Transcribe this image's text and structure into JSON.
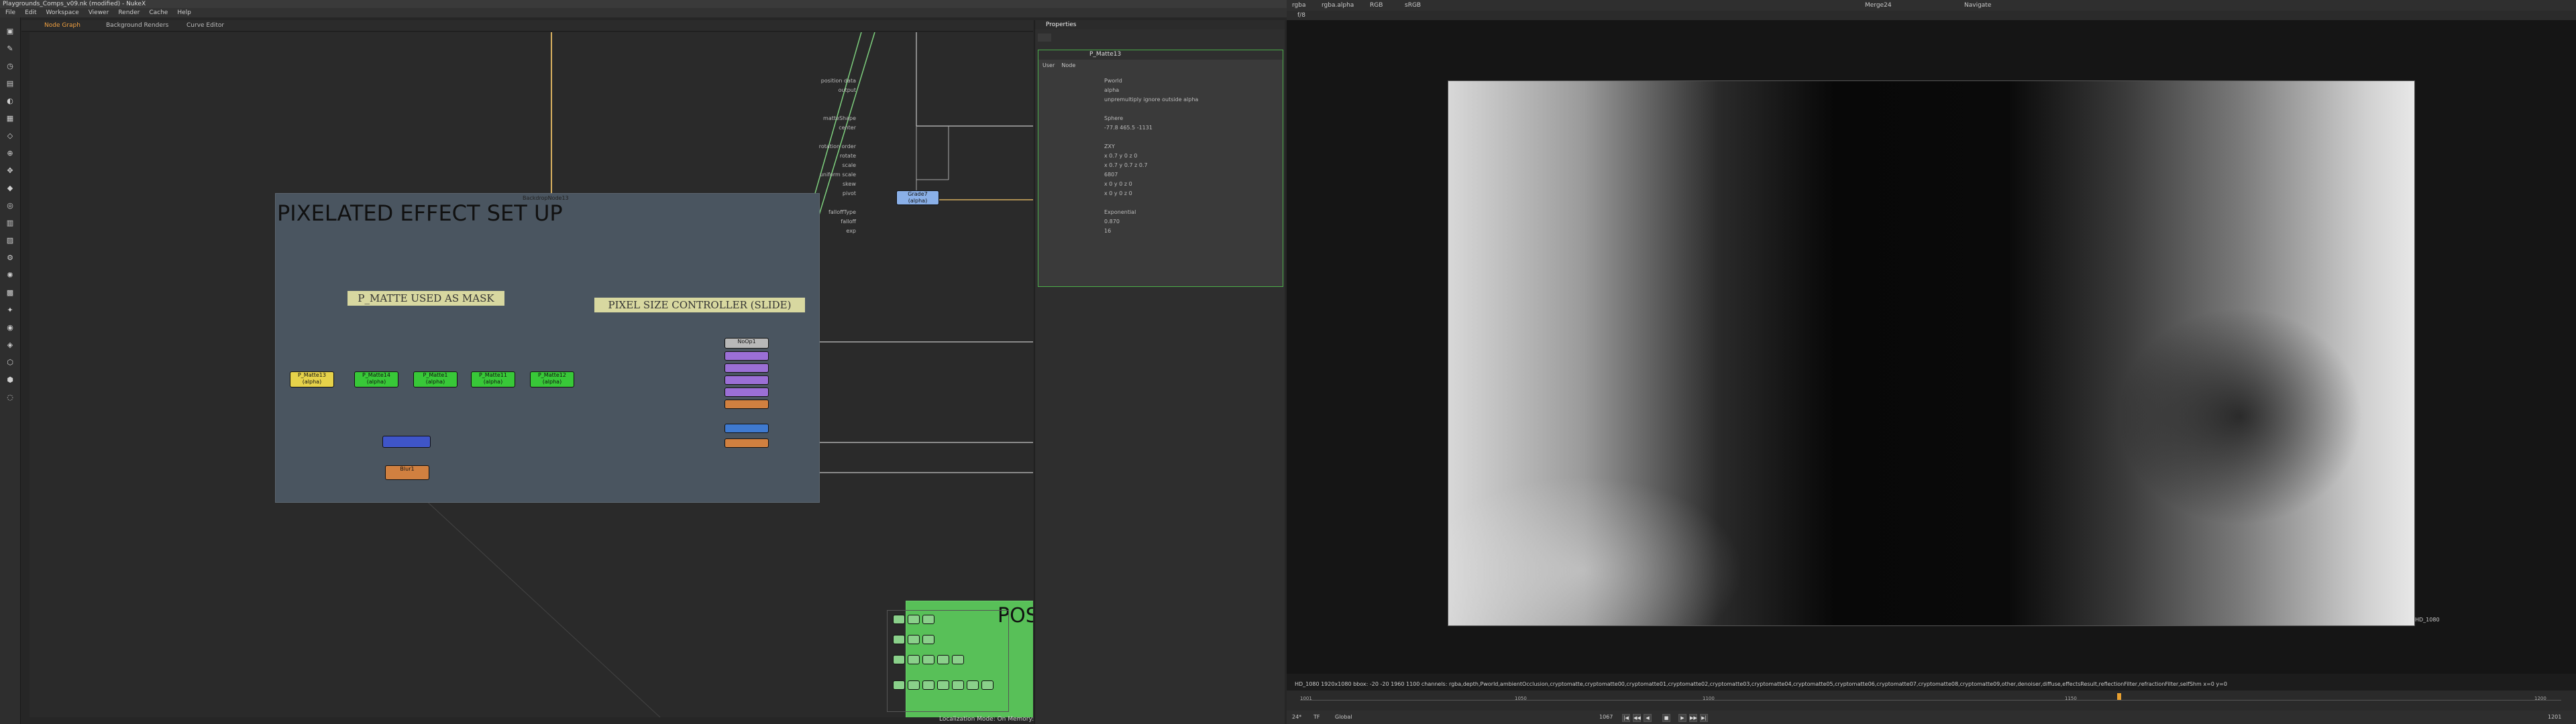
{
  "app": {
    "title": "Playgrounds_Comps_v09.nk (modified) - NukeX",
    "menu": [
      "File",
      "Edit",
      "Workspace",
      "Viewer",
      "Render",
      "Cache",
      "Help"
    ]
  },
  "toolbar": {
    "icons": [
      "image-icon",
      "draw-icon",
      "time-icon",
      "channel-icon",
      "color-icon",
      "filter-icon",
      "keyer-icon",
      "merge-icon",
      "transform-icon",
      "3d-icon",
      "views-icon",
      "metadata-icon",
      "toolsets-icon",
      "other-icon",
      "particles-icon",
      "deep-icon",
      "furnace-icon",
      "ocula-icon",
      "cara-icon",
      "gizmo-icon",
      "copycat-icon",
      "ml-icon"
    ]
  },
  "nodegraph": {
    "tabs": [
      "Node Graph",
      "Background Renders",
      "Curve Editor"
    ],
    "backdrop_label": "BackdropNode13",
    "backdrop_title": "PIXELATED EFFECT SET UP",
    "sticky1": "P_MATTE USED AS MASK",
    "sticky2": "PIXEL SIZE CONTROLLER (SLIDE)",
    "nodes": {
      "m1": "P_Matte13\n(alpha)",
      "m2": "P_Matte14\n(alpha)",
      "m3": "P_Matte1\n(alpha)",
      "m4": "P_Matte11\n(alpha)",
      "m5": "P_Matte12\n(alpha)",
      "grade": "Grade7\n(alpha)",
      "noop": "NoOp1",
      "blur": "Blur1",
      "post": "POST"
    },
    "status": "Localization Mode: On  Memory: 4.1 GB (26.2%)  CPU: 0.0%  Disk: 0.0 MB/s  Network: 0.0 MB/s"
  },
  "properties": {
    "title": "Properties",
    "node_name": "P_Matte13",
    "tabs": [
      "User",
      "Node"
    ],
    "rows": [
      {
        "label": "position data",
        "value": "Pworld"
      },
      {
        "label": "output",
        "value": "alpha"
      },
      {
        "label": "",
        "value": "unpremultiply   ignore outside alpha"
      },
      {
        "label": "matteShape",
        "value": "Sphere"
      },
      {
        "label": "center",
        "value": "-77.8     465.5     -1131"
      },
      {
        "label": "rotation order",
        "value": "ZXY"
      },
      {
        "label": "rotate",
        "value": "x 0.7     y 0      z 0"
      },
      {
        "label": "scale",
        "value": "x 0.7     y 0.7    z 0.7"
      },
      {
        "label": "uniform scale",
        "value": "6807"
      },
      {
        "label": "skew",
        "value": "x 0     y 0      z 0"
      },
      {
        "label": "pivot",
        "value": "x 0     y 0      z 0"
      },
      {
        "label": "falloffType",
        "value": "Exponential"
      },
      {
        "label": "falloff",
        "value": "0.870"
      },
      {
        "label": "exp",
        "value": "16"
      }
    ]
  },
  "viewer": {
    "channel": "rgba",
    "alpha": "rgba.alpha",
    "colorspace": "RGB",
    "lut": "sRGB",
    "input": "Merge24",
    "navigate": "Navigate",
    "zoom": "f/8",
    "frame_label": "HD_1080",
    "info": "HD_1080 1920x1080  bbox: -20 -20 1960 1100 channels: rgba,depth,Pworld,ambientOcclusion,cryptomatte,cryptomatte00,cryptomatte01,cryptomatte02,cryptomatte03,cryptomatte04,cryptomatte05,cryptomatte06,cryptomatte07,cryptomatte08,cryptomatte09,other,denoiser,diffuse,effectsResult,reflectionFilter,refractionFilter,selfShm  x=0 y=0",
    "timeline": {
      "ticks": [
        "1001",
        "1050",
        "1100",
        "1150",
        "1200"
      ],
      "current": "1067",
      "fps": "24*",
      "mode": "TF",
      "global": "Global",
      "end": "1201"
    }
  }
}
